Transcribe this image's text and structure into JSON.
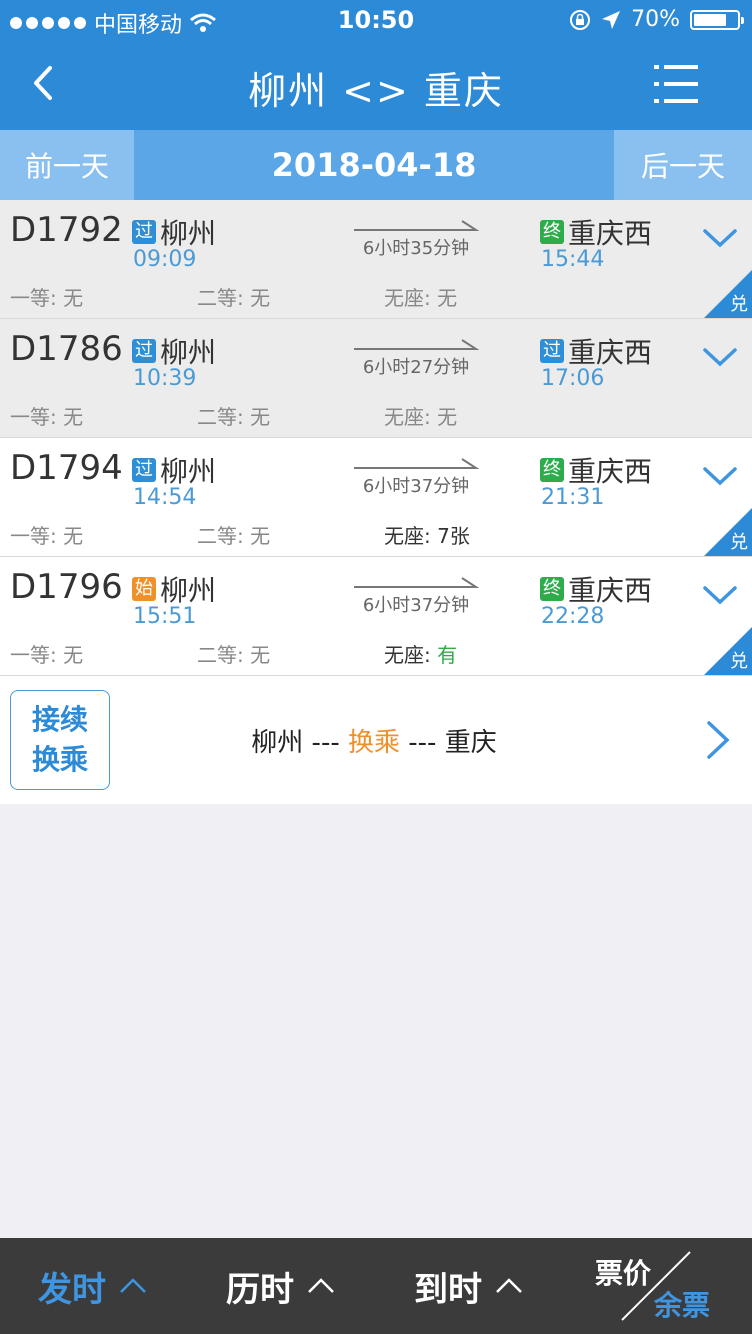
{
  "status": {
    "carrier": "中国移动",
    "time": "10:50",
    "battery": "70%"
  },
  "nav": {
    "title": "柳州 <> 重庆"
  },
  "datebar": {
    "prev": "前一天",
    "date": "2018-04-18",
    "next": "后一天"
  },
  "trains": [
    {
      "no": "D1792",
      "from_badge": "过",
      "from": "柳州",
      "dep": "09:09",
      "duration": "6小时35分钟",
      "to_badge": "终",
      "to": "重庆西",
      "arr": "15:44",
      "s1": "一等: 无",
      "s2": "二等: 无",
      "s3_label": "无座: ",
      "s3_value": "无",
      "corner": "兑"
    },
    {
      "no": "D1786",
      "from_badge": "过",
      "from": "柳州",
      "dep": "10:39",
      "duration": "6小时27分钟",
      "to_badge": "过",
      "to": "重庆西",
      "arr": "17:06",
      "s1": "一等: 无",
      "s2": "二等: 无",
      "s3_label": "无座: ",
      "s3_value": "无"
    },
    {
      "no": "D1794",
      "from_badge": "过",
      "from": "柳州",
      "dep": "14:54",
      "duration": "6小时37分钟",
      "to_badge": "终",
      "to": "重庆西",
      "arr": "21:31",
      "s1": "一等: 无",
      "s2": "二等: 无",
      "s3_label": "无座: ",
      "s3_value": "7张",
      "corner": "兑"
    },
    {
      "no": "D1796",
      "from_badge": "始",
      "from": "柳州",
      "dep": "15:51",
      "duration": "6小时37分钟",
      "to_badge": "终",
      "to": "重庆西",
      "arr": "22:28",
      "s1": "一等: 无",
      "s2": "二等: 无",
      "s3_label": "无座: ",
      "s3_value": "有",
      "corner": "兑"
    }
  ],
  "transfer": {
    "btn_line1": "接续",
    "btn_line2": "换乘",
    "from": "柳州",
    "sep1": " --- ",
    "mid": "换乘",
    "sep2": " --- ",
    "to": "重庆"
  },
  "bottom": {
    "tab1": "发时",
    "tab2": "历时",
    "tab3": "到时",
    "price": "票价",
    "remain": "余票"
  },
  "colors": {
    "primary": "#2d8ad6",
    "accent_orange": "#f0902b",
    "green": "#2eab4b"
  }
}
